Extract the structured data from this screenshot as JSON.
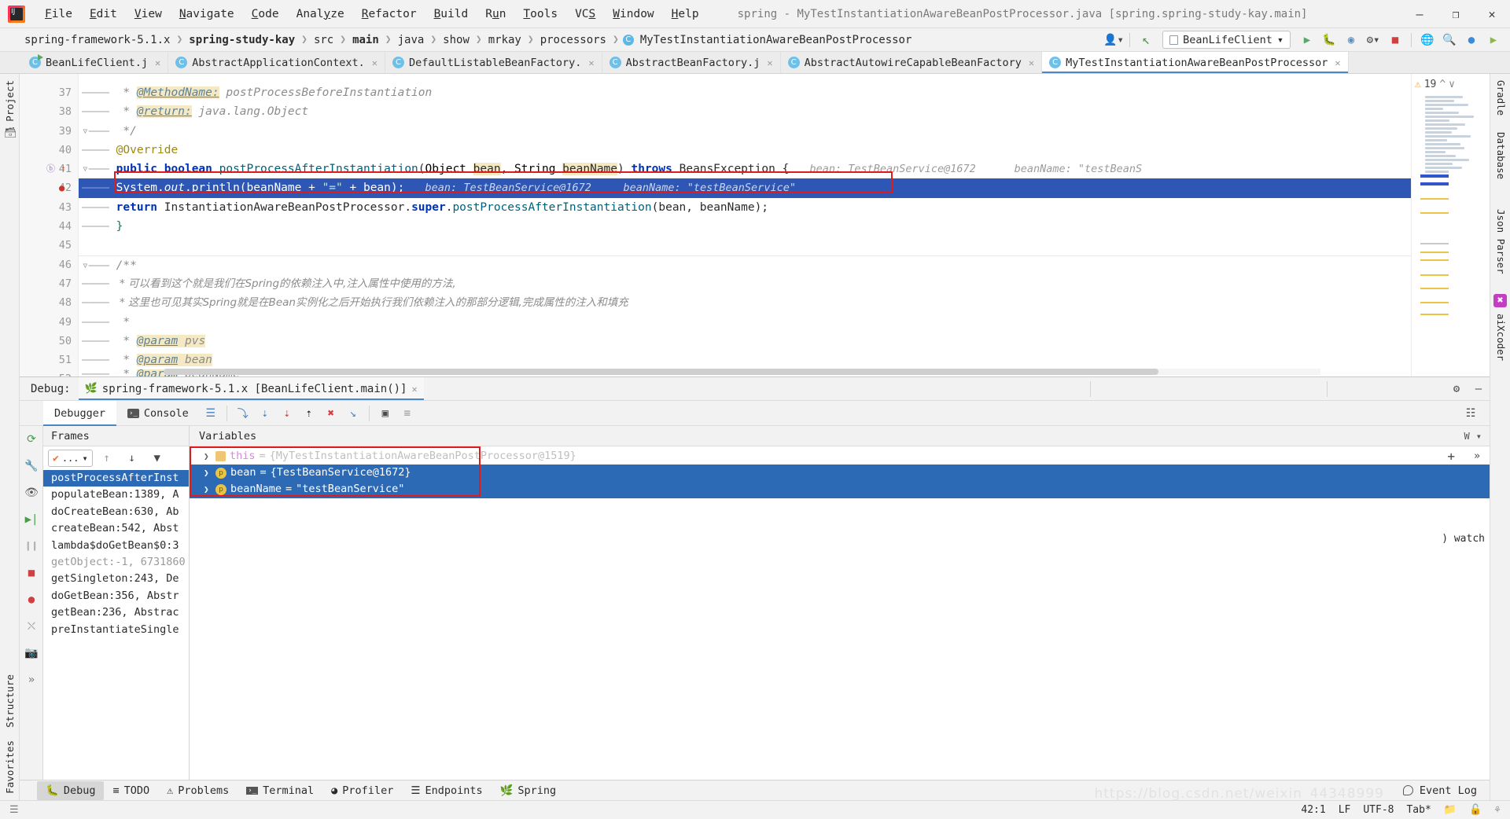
{
  "window": {
    "title": "spring - MyTestInstantiationAwareBeanPostProcessor.java [spring.spring-study-kay.main]",
    "minimize": "—",
    "maximize": "❐",
    "close": "✕"
  },
  "menu": [
    {
      "label": "File"
    },
    {
      "label": "Edit"
    },
    {
      "label": "View"
    },
    {
      "label": "Navigate"
    },
    {
      "label": "Code"
    },
    {
      "label": "Analyze"
    },
    {
      "label": "Refactor"
    },
    {
      "label": "Build"
    },
    {
      "label": "Run"
    },
    {
      "label": "Tools"
    },
    {
      "label": "VCS"
    },
    {
      "label": "Window"
    },
    {
      "label": "Help"
    }
  ],
  "breadcrumb": [
    {
      "label": "spring-framework-5.1.x",
      "bold": false
    },
    {
      "label": "spring-study-kay",
      "bold": true
    },
    {
      "label": "src",
      "bold": false
    },
    {
      "label": "main",
      "bold": true
    },
    {
      "label": "java",
      "bold": false
    },
    {
      "label": "show",
      "bold": false
    },
    {
      "label": "mrkay",
      "bold": false
    },
    {
      "label": "processors",
      "bold": false
    },
    {
      "label": "MyTestInstantiationAwareBeanPostProcessor",
      "bold": false,
      "icon": "class-icon"
    }
  ],
  "navbar_right": {
    "run_config": "BeanLifeClient",
    "dropdown_caret": "▾"
  },
  "editor_tabs": [
    {
      "label": "BeanLifeClient.j",
      "icon": "java-run-class-icon",
      "active": false
    },
    {
      "label": "AbstractApplicationContext.",
      "icon": "java-class-icon",
      "active": false
    },
    {
      "label": "DefaultListableBeanFactory.",
      "icon": "java-class-icon",
      "active": false
    },
    {
      "label": "AbstractBeanFactory.j",
      "icon": "java-class-icon",
      "active": false
    },
    {
      "label": "AbstractAutowireCapableBeanFactory",
      "icon": "java-class-icon",
      "active": false
    },
    {
      "label": "MyTestInstantiationAwareBeanPostProcessor",
      "icon": "java-class-icon",
      "active": true
    }
  ],
  "editor": {
    "warning_count": "19",
    "warning_icon": "warning-triangle-icon",
    "lines": [
      {
        "n": "37",
        "type": "comment",
        "text": " * @MethodName: postProcessBeforeInstantiation",
        "tag": "@MethodName:",
        "rest": " postProcessBeforeInstantiation",
        "pre": " * "
      },
      {
        "n": "38",
        "type": "comment",
        "text": " * @return: java.lang.Object",
        "tag": "@return:",
        "rest": " java.lang.Object",
        "pre": " * "
      },
      {
        "n": "39",
        "type": "comment_end",
        "text": " */"
      },
      {
        "n": "40",
        "type": "annotation",
        "text": "@Override"
      },
      {
        "n": "41",
        "type": "signature",
        "text": "public boolean postProcessAfterInstantiation(Object bean, String beanName) throws BeansException {",
        "inline": "bean: TestBeanService@1672      beanName: \"testBeanS"
      },
      {
        "n": "42",
        "type": "selected",
        "text": "System.out.println(beanName + \"=\" + bean);",
        "inline": "bean: TestBeanService@1672     beanName: \"testBeanService\""
      },
      {
        "n": "43",
        "type": "return",
        "text": "return InstantiationAwareBeanPostProcessor.super.postProcessAfterInstantiation(bean, beanName);"
      },
      {
        "n": "44",
        "type": "brace",
        "text": "}"
      },
      {
        "n": "45",
        "type": "blank",
        "text": ""
      },
      {
        "n": "46",
        "type": "comment_start",
        "text": "/**"
      },
      {
        "n": "47",
        "type": "comment_cn",
        "text": " * 可以看到这个就是我们在Spring的依赖注入中,注入属性中使用的方法,"
      },
      {
        "n": "48",
        "type": "comment_cn",
        "text": " * 这里也可见其实Spring就是在Bean实例化之后开始执行我们依赖注入的那部分逻辑,完成属性的注入和填充"
      },
      {
        "n": "49",
        "type": "comment",
        "text": " * ",
        "pre": " * ",
        "tag": "",
        "rest": ""
      },
      {
        "n": "50",
        "type": "comment",
        "text": " * @param pvs",
        "pre": " * ",
        "tag": "@param",
        "rest": " pvs"
      },
      {
        "n": "51",
        "type": "comment",
        "text": " * @param bean",
        "pre": " * ",
        "tag": "@param",
        "rest": " bean"
      },
      {
        "n": "52",
        "type": "comment",
        "text": " * @param beanName",
        "pre": " * ",
        "tag": "@param",
        "rest": " beanName"
      }
    ]
  },
  "debug": {
    "panel_label": "Debug:",
    "session_name": "spring-framework-5.1.x [BeanLifeClient.main()]",
    "session_icon": "spring-leaf-icon",
    "close_session": "✕",
    "settings_icon": "gear-icon",
    "hide_icon": "minimize-icon",
    "tabs": [
      {
        "label": "Debugger",
        "icon": "debugger-icon",
        "active": true
      },
      {
        "label": "Console",
        "icon": "console-icon",
        "active": false
      }
    ],
    "toolbar_icons": [
      "rerun-icon",
      "layout-icon",
      "step-over-icon",
      "step-into-icon",
      "force-step-into-icon",
      "step-out-icon",
      "drop-frame-icon",
      "run-to-cursor-icon",
      "evaluate-expression-icon",
      "mute-breakpoints-icon",
      "restore-layout-icon"
    ],
    "rail_icons": [
      "rerun-icon",
      "settings-wrench-icon",
      "watch-eye-icon",
      "resume-icon",
      "pause-icon",
      "stop-icon",
      "breakpoints-icon",
      "mute-breakpoints-icon",
      "camera-icon",
      "expand-icon"
    ],
    "frames": {
      "header": "Frames",
      "thread_selector": "...",
      "thread_caret": "▾",
      "up_icon": "arrow-up-icon",
      "down_icon": "arrow-down-icon",
      "filter_icon": "filter-icon",
      "rows": [
        {
          "label": "postProcessAfterInst",
          "active": true,
          "dim": false
        },
        {
          "label": "populateBean:1389, A",
          "active": false,
          "dim": false
        },
        {
          "label": "doCreateBean:630, Ab",
          "active": false,
          "dim": false
        },
        {
          "label": "createBean:542, Abst",
          "active": false,
          "dim": false
        },
        {
          "label": "lambda$doGetBean$0:3",
          "active": false,
          "dim": false
        },
        {
          "label": "getObject:-1, 6731860",
          "active": false,
          "dim": true
        },
        {
          "label": "getSingleton:243, De",
          "active": false,
          "dim": false
        },
        {
          "label": "doGetBean:356, Abstr",
          "active": false,
          "dim": false
        },
        {
          "label": "getBean:236, Abstrac",
          "active": false,
          "dim": false
        },
        {
          "label": "preInstantiateSingle",
          "active": false,
          "dim": false
        }
      ]
    },
    "variables": {
      "header": "Variables",
      "header_right": [
        "W",
        "▾"
      ],
      "add_icon": "plus-icon",
      "more_icon": "chevrons-right-icon",
      "watches_label": "watch",
      "rows": [
        {
          "arrow": "❯",
          "icon": "field-icon",
          "name": "this",
          "eq": " = ",
          "value": "{MyTestInstantiationAwareBeanPostProcessor@1519}",
          "selected": false,
          "faded": true
        },
        {
          "arrow": "❯",
          "icon": "param-icon",
          "name": "bean",
          "eq": " = ",
          "value": "{TestBeanService@1672}",
          "selected": true,
          "faded": false
        },
        {
          "arrow": "❯",
          "icon": "param-icon",
          "name": "beanName",
          "eq": " = ",
          "value": "\"testBeanService\"",
          "selected": true,
          "faded": false
        }
      ]
    }
  },
  "left_rail": [
    {
      "label": "Project",
      "icon": "project-icon"
    },
    {
      "label": "",
      "icon": "structure-icon"
    }
  ],
  "left_rail_bottom": [
    {
      "label": "Structure",
      "icon": "structure-icon"
    },
    {
      "label": "Favorites",
      "icon": "favorites-star-icon"
    }
  ],
  "right_rail": [
    {
      "label": "Gradle",
      "icon": "gradle-icon"
    },
    {
      "label": "Database",
      "icon": "database-icon"
    },
    {
      "label": "Json Parser",
      "icon": "json-icon"
    },
    {
      "label": "aiXcoder",
      "icon": "aixcoder-icon"
    }
  ],
  "bottom_tools": [
    {
      "label": "Debug",
      "icon": "debug-bug-icon",
      "active": true
    },
    {
      "label": "TODO",
      "icon": "todo-list-icon",
      "active": false
    },
    {
      "label": "Problems",
      "icon": "problems-icon",
      "active": false
    },
    {
      "label": "Terminal",
      "icon": "terminal-icon",
      "active": false
    },
    {
      "label": "Profiler",
      "icon": "profiler-icon",
      "active": false
    },
    {
      "label": "Endpoints",
      "icon": "endpoints-icon",
      "active": false
    },
    {
      "label": "Spring",
      "icon": "spring-leaf-icon",
      "active": false
    }
  ],
  "bottom_right": {
    "event_log": "Event Log",
    "event_log_icon": "event-log-icon"
  },
  "statusbar": {
    "caret": "42:1",
    "line_sep": "LF",
    "encoding": "UTF-8",
    "indent": "Tab*",
    "icons": [
      "git-branch-icon",
      "lock-icon",
      "inspection-icon"
    ],
    "watermark": "https://blog.csdn.net/weixin_44348999"
  },
  "colors": {
    "accent_blue": "#2d6ab5",
    "selection_blue": "#2d56b5",
    "highlight_red": "#e01b1b",
    "keyword": "#0033b3",
    "string": "#067d17",
    "comment": "#8c8c8c",
    "annotation": "#9e880d"
  }
}
